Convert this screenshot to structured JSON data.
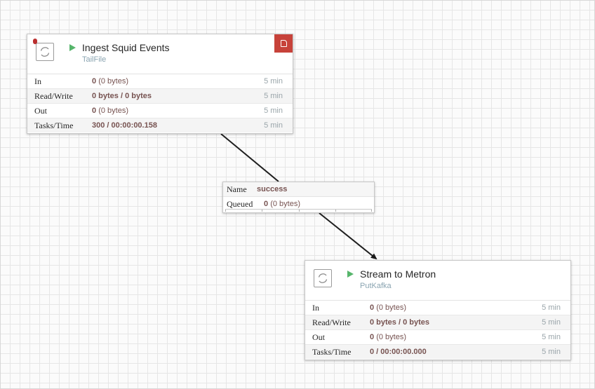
{
  "colors": {
    "canvas_background": "#fbfbfb",
    "grid_line": "#e6e6e6",
    "run_indicator": "#56b56b",
    "invalid_badge": "#ba2f2f",
    "comment_badge": "#c7423a",
    "stat_value": "#775351",
    "processor_type": "#8aa4b1"
  },
  "processors": [
    {
      "name": "Ingest Squid Events",
      "type": "TailFile",
      "state": "running",
      "icons": [
        "processor-icon",
        "run-icon",
        "invalid-badge",
        "comment-icon"
      ],
      "stats": [
        {
          "label": "In",
          "value": "0",
          "detail": "(0 bytes)",
          "time": "5 min"
        },
        {
          "label": "Read/Write",
          "value": "0 bytes / 0 bytes",
          "detail": "",
          "time": "5 min"
        },
        {
          "label": "Out",
          "value": "0",
          "detail": "(0 bytes)",
          "time": "5 min"
        },
        {
          "label": "Tasks/Time",
          "value": "300 / 00:00:00.158",
          "detail": "",
          "time": "5 min"
        }
      ]
    },
    {
      "name": "Stream to Metron",
      "type": "PutKafka",
      "state": "running",
      "icons": [
        "processor-icon",
        "run-icon"
      ],
      "stats": [
        {
          "label": "In",
          "value": "0",
          "detail": "(0 bytes)",
          "time": "5 min"
        },
        {
          "label": "Read/Write",
          "value": "0 bytes / 0 bytes",
          "detail": "",
          "time": "5 min"
        },
        {
          "label": "Out",
          "value": "0",
          "detail": "(0 bytes)",
          "time": "5 min"
        },
        {
          "label": "Tasks/Time",
          "value": "0 / 00:00:00.000",
          "detail": "",
          "time": "5 min"
        }
      ]
    }
  ],
  "connection": {
    "name_label": "Name",
    "name_value": "success",
    "queued_label": "Queued",
    "queued_value": "0",
    "queued_detail": "(0 bytes)",
    "queue_fill_fraction": 0
  }
}
